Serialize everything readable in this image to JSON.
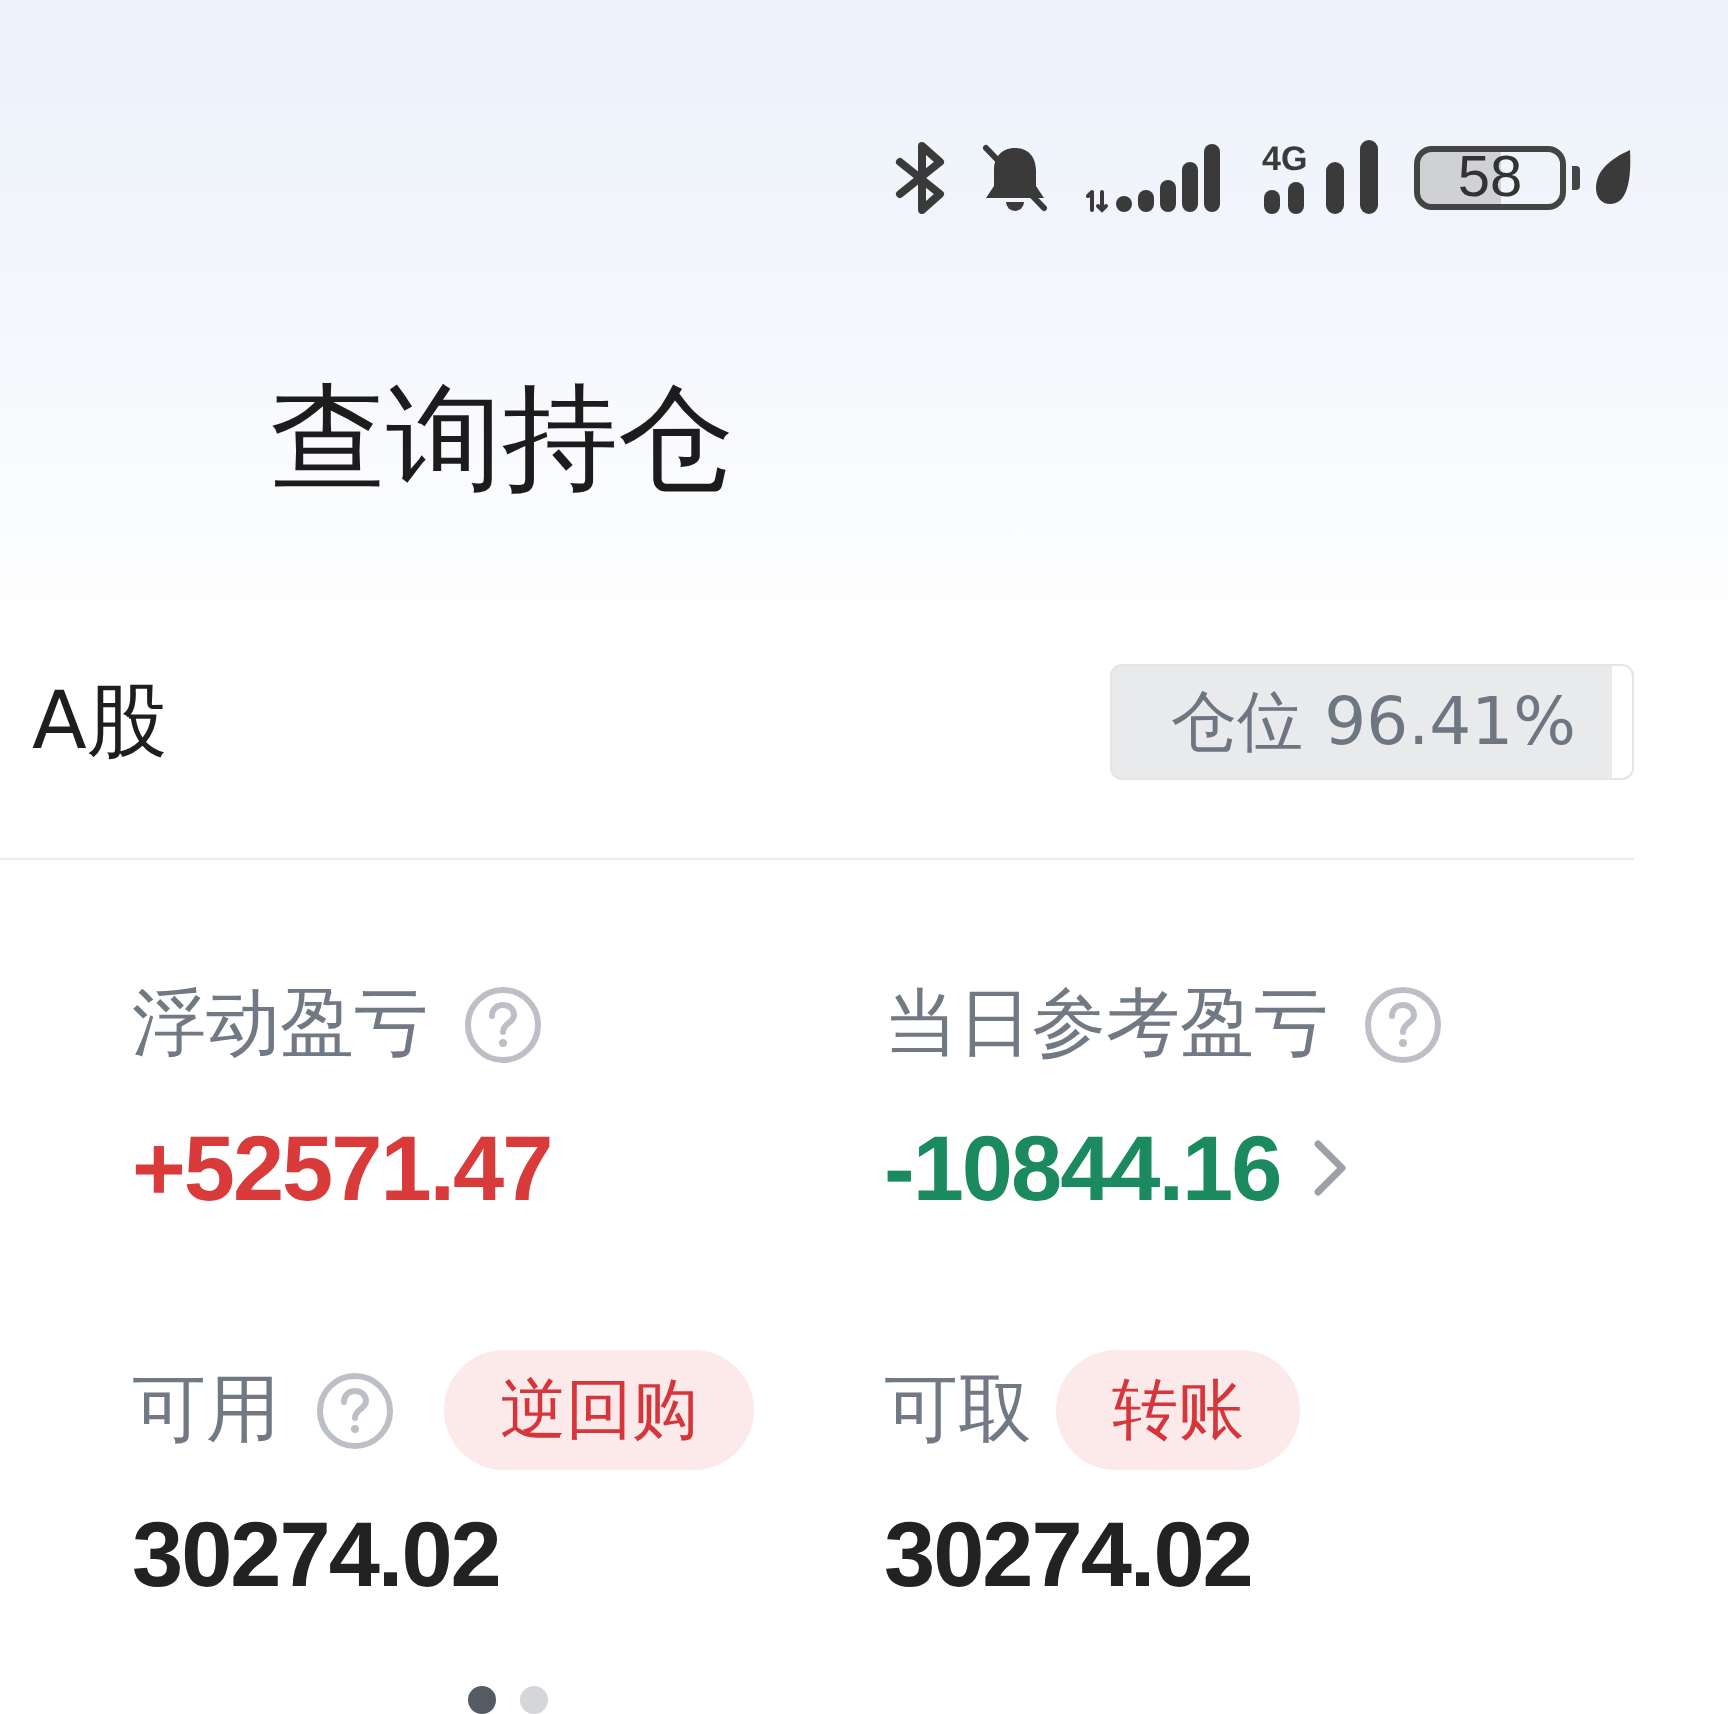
{
  "status_bar": {
    "network": "4G",
    "battery": "58"
  },
  "header": {
    "title": "查询持仓"
  },
  "market": {
    "name": "A股",
    "position_badge": "仓位 96.41%"
  },
  "metrics": [
    {
      "label": "浮动盈亏",
      "help": true,
      "value": "+52571.47",
      "color": "#d93a3a",
      "chevron": false
    },
    {
      "label": "当日参考盈亏",
      "help": true,
      "value": "-10844.16",
      "color": "#1b8a5f",
      "chevron": true
    },
    {
      "label": "可用",
      "help": true,
      "action": "逆回购",
      "value": "30274.02",
      "color": "#222222",
      "chevron": false
    },
    {
      "label": "可取",
      "help": false,
      "action": "转账",
      "value": "30274.02",
      "color": "#222222",
      "chevron": false
    }
  ],
  "pager": [
    {
      "selected": true
    },
    {
      "selected": false
    }
  ]
}
